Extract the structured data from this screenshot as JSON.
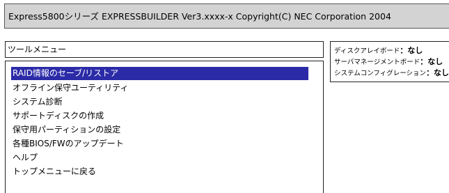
{
  "title_bar": {
    "text": "Express5800シリーズ EXPRESSBUILDER Ver3.xxxx-x Copyright(C) NEC Corporation 2004"
  },
  "menu": {
    "header": "ツールメニュー",
    "items": [
      {
        "label": "RAID情報のセーブ/リストア",
        "selected": true
      },
      {
        "label": "オフライン保守ユーティリティ",
        "selected": false
      },
      {
        "label": "システム診断",
        "selected": false
      },
      {
        "label": "サポートディスクの作成",
        "selected": false
      },
      {
        "label": "保守用パーティションの設定",
        "selected": false
      },
      {
        "label": "各種BIOS/FWのアップデート",
        "selected": false
      },
      {
        "label": "ヘルプ",
        "selected": false
      },
      {
        "label": "トップメニューに戻る",
        "selected": false
      }
    ]
  },
  "info": {
    "rows": [
      {
        "label": "ディスクアレイボード",
        "value": "：なし"
      },
      {
        "label": "サーバマネージメントボード",
        "value": "：なし"
      },
      {
        "label": "システムコンフィグレーション",
        "value": "：なし"
      }
    ]
  },
  "colors": {
    "selection": "#2b2ba8",
    "title_bar_bg": "#d3d3d3"
  }
}
